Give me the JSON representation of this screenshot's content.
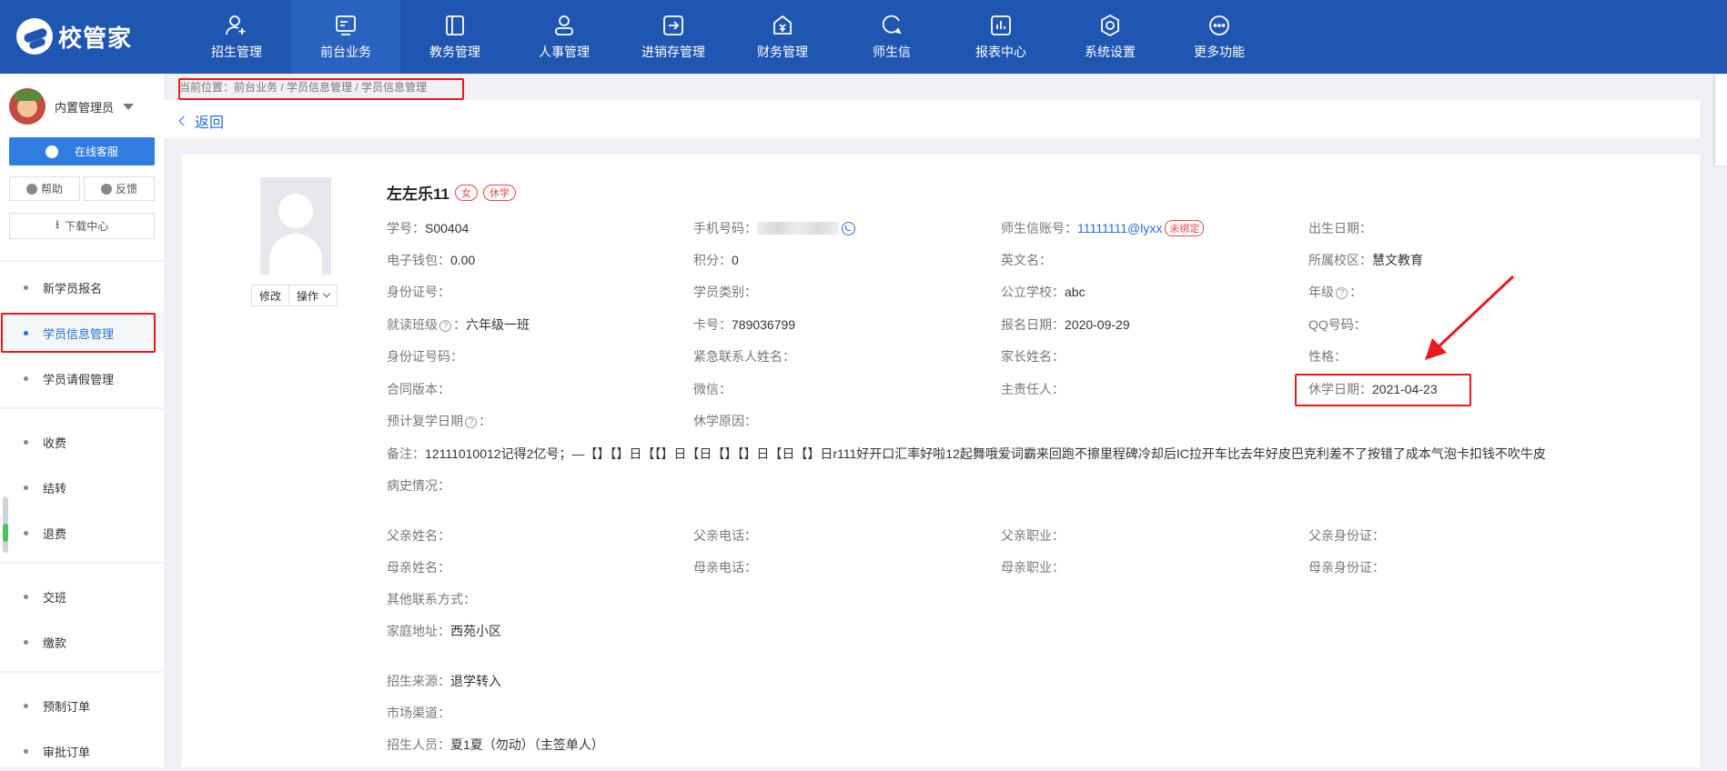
{
  "app": {
    "logo": "校管家"
  },
  "nav": [
    {
      "label": "招生管理",
      "icon": "user-add-icon"
    },
    {
      "label": "前台业务",
      "icon": "monitor-icon",
      "active": true
    },
    {
      "label": "教务管理",
      "icon": "book-icon"
    },
    {
      "label": "人事管理",
      "icon": "person-icon"
    },
    {
      "label": "进销存管理",
      "icon": "box-arrow-icon"
    },
    {
      "label": "财务管理",
      "icon": "money-bag-icon"
    },
    {
      "label": "师生信",
      "icon": "chat-icon"
    },
    {
      "label": "报表中心",
      "icon": "bar-chart-icon"
    },
    {
      "label": "系统设置",
      "icon": "gear-icon"
    },
    {
      "label": "更多功能",
      "icon": "more-icon"
    }
  ],
  "sidebar": {
    "user_name": "内置管理员",
    "service_btn": "在线客服",
    "help_btn": "帮助",
    "feedback_btn": "反馈",
    "download_btn": "下载中心",
    "groups": [
      [
        "新学员报名",
        "学员信息管理",
        "学员请假管理"
      ],
      [
        "收费",
        "结转",
        "退费"
      ],
      [
        "交班",
        "缴款"
      ],
      [
        "预制订单",
        "审批订单"
      ]
    ],
    "active": "学员信息管理"
  },
  "breadcrumb": "当前位置：前台业务 / 学员信息管理 / 学员信息管理",
  "back": "返回",
  "student": {
    "name": "左左乐11",
    "tags": [
      "女",
      "休学"
    ],
    "photo_buttons": {
      "edit": "修改",
      "ops": "操作"
    },
    "fields": {
      "student_no": {
        "label": "学号：",
        "value": "S00404"
      },
      "phone": {
        "label": "手机号码：",
        "value": ""
      },
      "account": {
        "label": "师生信账号：",
        "value": "11111111@lyxx",
        "badge": "未绑定"
      },
      "birthday": {
        "label": "出生日期：",
        "value": ""
      },
      "wallet": {
        "label": "电子钱包：",
        "value": "0.00"
      },
      "points": {
        "label": "积分：",
        "value": "0"
      },
      "english_name": {
        "label": "英文名：",
        "value": ""
      },
      "campus": {
        "label": "所属校区：",
        "value": "慧文教育"
      },
      "id_no": {
        "label": "身份证号：",
        "value": ""
      },
      "category": {
        "label": "学员类别：",
        "value": ""
      },
      "school": {
        "label": "公立学校：",
        "value": "abc"
      },
      "grade": {
        "label": "年级",
        "value": ""
      },
      "class": {
        "label": "就读班级",
        "value": "六年级一班"
      },
      "card": {
        "label": "卡号：",
        "value": "789036799"
      },
      "reg_date": {
        "label": "报名日期：",
        "value": "2020-09-29"
      },
      "qq": {
        "label": "QQ号码：",
        "value": ""
      },
      "id_code": {
        "label": "身份证号码：",
        "value": ""
      },
      "emergency": {
        "label": "紧急联系人姓名：",
        "value": ""
      },
      "parent": {
        "label": "家长姓名：",
        "value": ""
      },
      "gender": {
        "label": "性格：",
        "value": ""
      },
      "contract": {
        "label": "合同版本：",
        "value": ""
      },
      "wechat": {
        "label": "微信：",
        "value": ""
      },
      "manager": {
        "label": "主责任人：",
        "value": ""
      },
      "suspend_date": {
        "label": "休学日期：",
        "value": "2021-04-23"
      },
      "resume_date": {
        "label": "预计复学日期",
        "value": ""
      },
      "suspend_reason": {
        "label": "休学原因：",
        "value": ""
      },
      "remark": {
        "label": "备注：",
        "value": "12111010012记得2亿号；—【】【】日【【】日【日【】【】日【日【】日r111好开口汇率好啦12起舞哦爱词霸来回跑不擦里程碑冷却后IC拉开车比去年好皮巴克利差不了按错了成本气泡卡扣钱不吹牛皮"
      },
      "medical": {
        "label": "病史情况：",
        "value": ""
      },
      "father_name": {
        "label": "父亲姓名：",
        "value": ""
      },
      "father_phone": {
        "label": "父亲电话：",
        "value": ""
      },
      "father_job": {
        "label": "父亲职业：",
        "value": ""
      },
      "father_id": {
        "label": "父亲身份证：",
        "value": ""
      },
      "mother_name": {
        "label": "母亲姓名：",
        "value": ""
      },
      "mother_phone": {
        "label": "母亲电话：",
        "value": ""
      },
      "mother_job": {
        "label": "母亲职业：",
        "value": ""
      },
      "mother_id": {
        "label": "母亲身份证：",
        "value": ""
      },
      "other_contact": {
        "label": "其他联系方式：",
        "value": ""
      },
      "address": {
        "label": "家庭地址：",
        "value": "西苑小区"
      },
      "source": {
        "label": "招生来源：",
        "value": "退学转入"
      },
      "channel": {
        "label": "市场渠道：",
        "value": ""
      },
      "recruiter": {
        "label": "招生人员：",
        "value": "夏1夏（勿动）（主签单人）"
      }
    }
  },
  "colors": {
    "topbar": "#1f56b2",
    "accent": "#1f6fd8",
    "highlight": "#e8191f"
  }
}
